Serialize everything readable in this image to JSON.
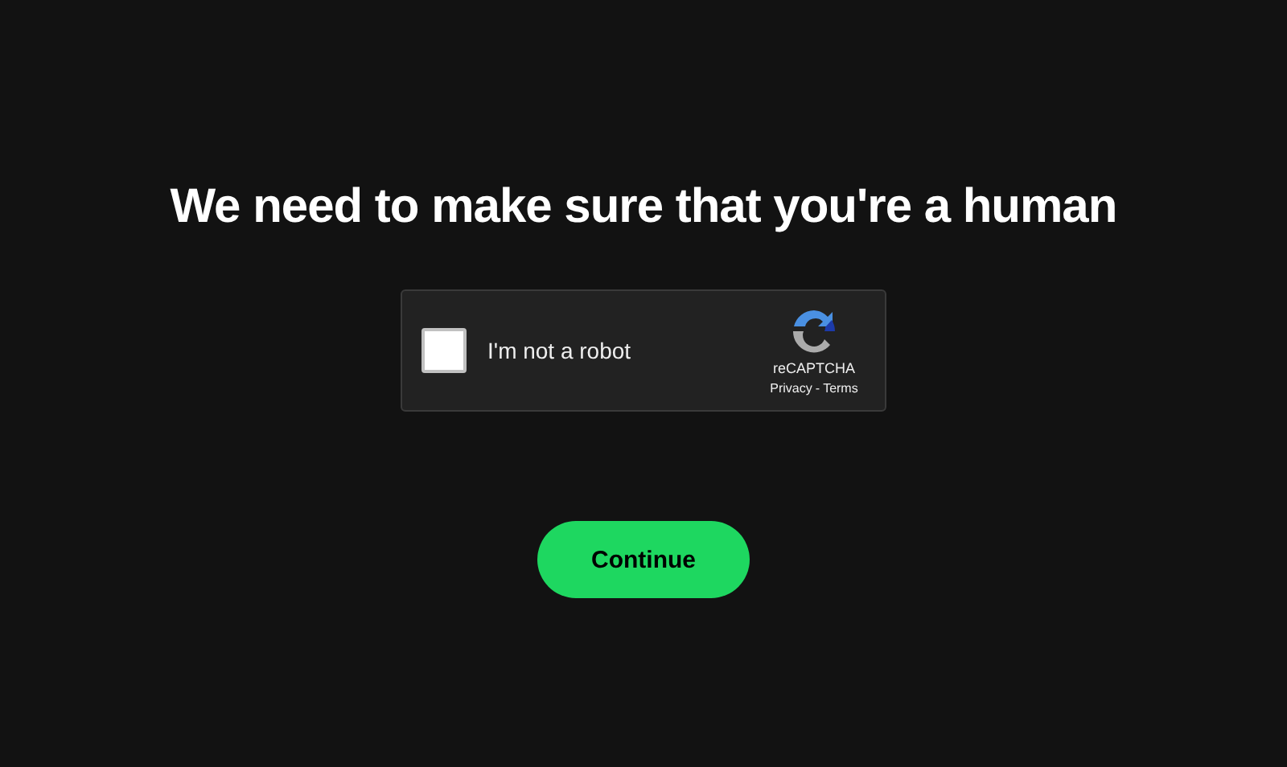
{
  "heading": "We need to make sure that you're a human",
  "captcha": {
    "label": "I'm not a robot",
    "checked": false,
    "brand": "reCAPTCHA",
    "links": [
      "Privacy",
      "Terms"
    ],
    "separator": "-"
  },
  "button": {
    "label": "Continue"
  }
}
